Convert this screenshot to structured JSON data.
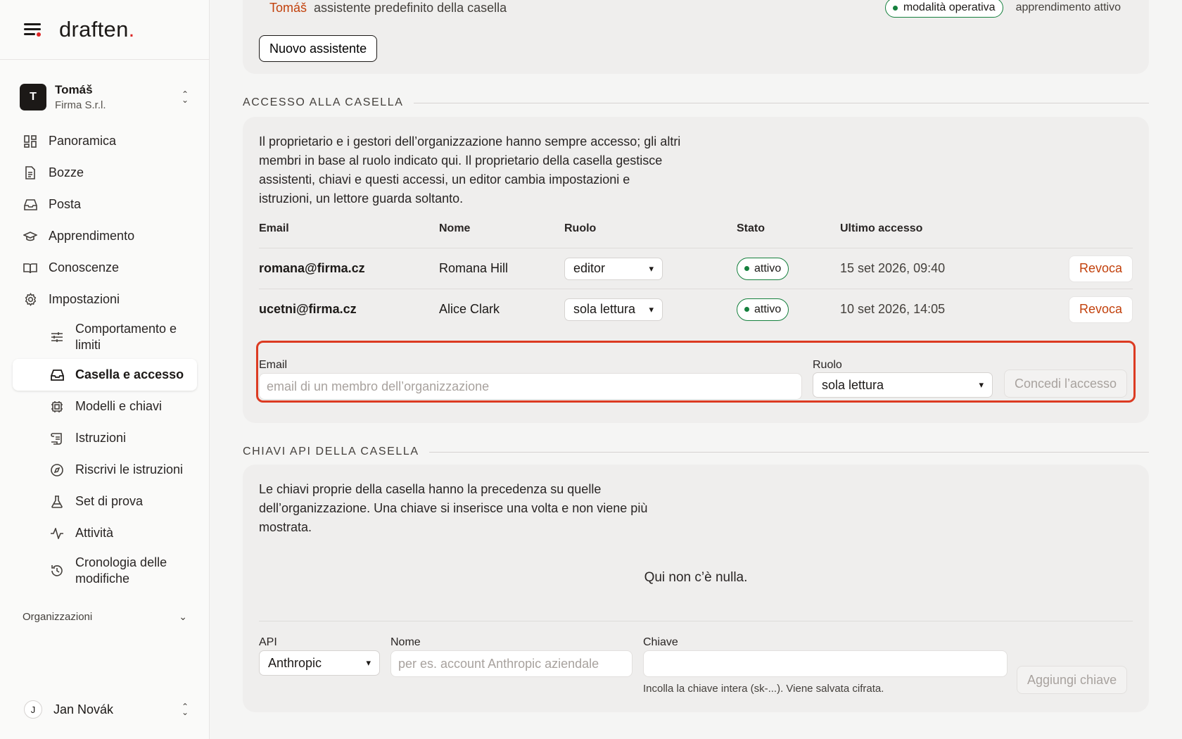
{
  "brand": {
    "logo": "draften",
    "logo_dot": "."
  },
  "org_switch": {
    "avatar_initial": "T",
    "name": "Tomáš",
    "subtitle": "Firma S.r.l."
  },
  "nav": {
    "items": [
      {
        "label": "Panoramica",
        "icon": "dashboard-icon"
      },
      {
        "label": "Bozze",
        "icon": "document-icon"
      },
      {
        "label": "Posta",
        "icon": "inbox-icon"
      },
      {
        "label": "Apprendimento",
        "icon": "graduation-cap-icon"
      },
      {
        "label": "Conoscenze",
        "icon": "book-icon"
      },
      {
        "label": "Impostazioni",
        "icon": "gear-icon"
      }
    ],
    "sub_items": [
      {
        "label": "Comportamento e limiti",
        "icon": "sliders-icon"
      },
      {
        "label": "Casella e accesso",
        "icon": "inbox-icon",
        "active": true
      },
      {
        "label": "Modelli e chiavi",
        "icon": "chip-icon"
      },
      {
        "label": "Istruzioni",
        "icon": "scroll-icon"
      },
      {
        "label": "Riscrivi le istruzioni",
        "icon": "compass-icon"
      },
      {
        "label": "Set di prova",
        "icon": "flask-icon"
      },
      {
        "label": "Attività",
        "icon": "activity-icon"
      },
      {
        "label": "Cronologia delle modifiche",
        "icon": "history-icon"
      }
    ],
    "section_organizations": "Organizzazioni"
  },
  "user": {
    "initial": "J",
    "name": "Jan Novák"
  },
  "assistant_card": {
    "owner": "Tomáš",
    "description": "assistente predefinito della casella",
    "mode_badge": "modalità operativa",
    "learning_status": "apprendimento attivo",
    "new_button": "Nuovo assistente"
  },
  "access": {
    "section_title": "ACCESSO ALLA CASELLA",
    "intro": "Il proprietario e i gestori dell’organizzazione hanno sempre accesso; gli altri membri in base al ruolo indicato qui. Il proprietario della casella gestisce assistenti, chiavi e questi accessi, un editor cambia impostazioni e istruzioni, un lettore guarda soltanto.",
    "columns": {
      "email": "Email",
      "name": "Nome",
      "role": "Ruolo",
      "status": "Stato",
      "last_access": "Ultimo accesso"
    },
    "rows": [
      {
        "email": "romana@firma.cz",
        "name": "Romana Hill",
        "role": "editor",
        "status": "attivo",
        "last_access": "15 set 2026, 09:40",
        "action": "Revoca"
      },
      {
        "email": "ucetni@firma.cz",
        "name": "Alice Clark",
        "role": "sola lettura",
        "status": "attivo",
        "last_access": "10 set 2026, 14:05",
        "action": "Revoca"
      }
    ],
    "grant": {
      "email_label": "Email",
      "email_placeholder": "email di un membro dell’organizzazione",
      "role_label": "Ruolo",
      "role_value": "sola lettura",
      "button": "Concedi l’accesso"
    }
  },
  "api_keys": {
    "section_title": "CHIAVI API DELLA CASELLA",
    "intro": "Le chiavi proprie della casella hanno la precedenza su quelle dell’organizzazione. Una chiave si inserisce una volta e non viene più mostrata.",
    "empty": "Qui non c’è nulla.",
    "api_label": "API",
    "api_value": "Anthropic",
    "name_label": "Nome",
    "name_placeholder": "per es. account Anthropic aziendale",
    "key_label": "Chiave",
    "key_hint": "Incolla la chiave intera (sk-...). Viene salvata cifrata.",
    "add_button": "Aggiungi chiave"
  },
  "colors": {
    "accent": "#dc2626",
    "status_green": "#15803d",
    "revoke": "#c2410c",
    "highlight": "#dc3b22"
  }
}
